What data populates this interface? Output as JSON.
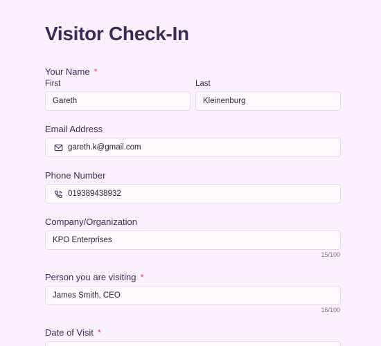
{
  "form": {
    "title": "Visitor Check-In",
    "name": {
      "label": "Your Name",
      "required_mark": "*",
      "first_label": "First",
      "first_value": "Gareth",
      "last_label": "Last",
      "last_value": "Kleinenburg"
    },
    "email": {
      "label": "Email Address",
      "value": "gareth.k@gmail.com",
      "icon": "envelope-icon"
    },
    "phone": {
      "label": "Phone Number",
      "value": "019389438932",
      "icon": "phone-icon"
    },
    "company": {
      "label": "Company/Organization",
      "value": "KPO Enterprises",
      "counter": "15/100"
    },
    "visiting": {
      "label": "Person you are visiting",
      "required_mark": "*",
      "value": "James Smith, CEO",
      "counter": "16/100"
    },
    "date": {
      "label": "Date of Visit",
      "required_mark": "*"
    }
  },
  "colors": {
    "background": "#fbf0fd",
    "title": "#3d2a52",
    "required": "#e0407a",
    "field_bg": "#fff9fd",
    "field_border": "#e3d8ea"
  }
}
